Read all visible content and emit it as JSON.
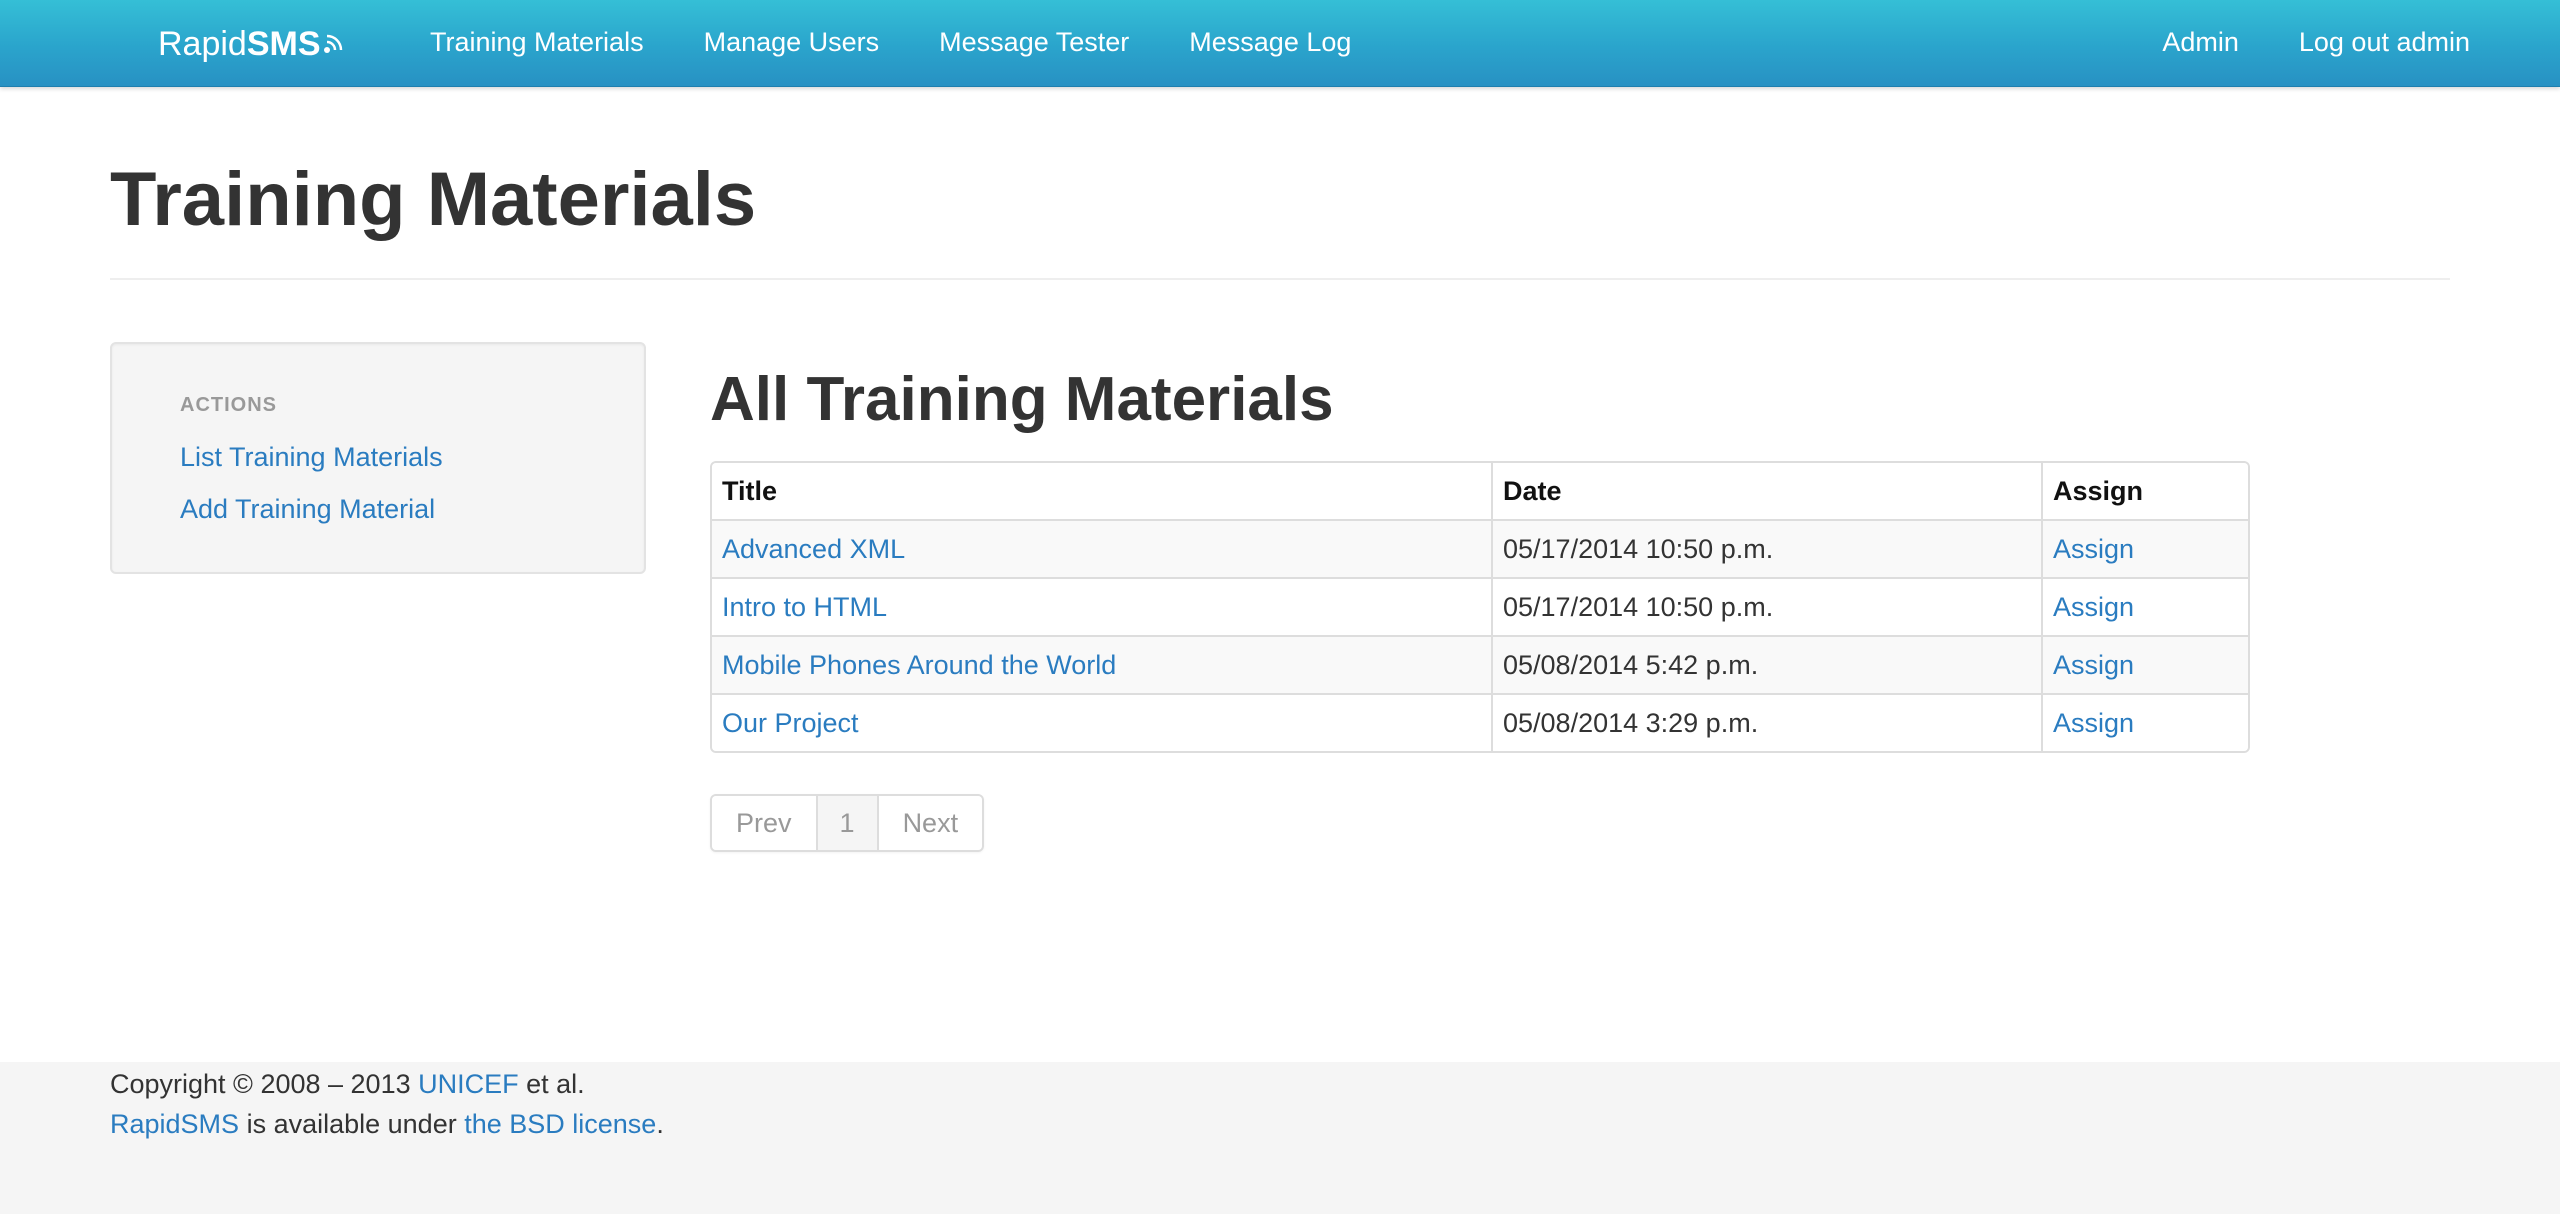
{
  "navbar": {
    "brand_light": "Rapid",
    "brand_bold": "SMS",
    "brand_icon": "signal-waves-icon",
    "left_items": [
      "Training Materials",
      "Manage Users",
      "Message Tester",
      "Message Log"
    ],
    "right_items": [
      "Admin",
      "Log out admin"
    ],
    "colors": {
      "gradient_top": "#35bfd6",
      "gradient_bottom": "#2891c3"
    }
  },
  "page": {
    "title": "Training Materials"
  },
  "sidebar": {
    "header": "ACTIONS",
    "links": [
      "List Training Materials",
      "Add Training Material"
    ]
  },
  "main": {
    "section_title": "All Training Materials",
    "table": {
      "columns": [
        "Title",
        "Date",
        "Assign"
      ],
      "rows": [
        {
          "title": "Advanced XML",
          "date": "05/17/2014 10:50 p.m.",
          "assign": "Assign"
        },
        {
          "title": "Intro to HTML",
          "date": "05/17/2014 10:50 p.m.",
          "assign": "Assign"
        },
        {
          "title": "Mobile Phones Around the World",
          "date": "05/08/2014 5:42 p.m.",
          "assign": "Assign"
        },
        {
          "title": "Our Project",
          "date": "05/08/2014 3:29 p.m.",
          "assign": "Assign"
        }
      ]
    },
    "pagination": {
      "prev": "Prev",
      "current": "1",
      "next": "Next"
    }
  },
  "footer": {
    "line1_prefix": "Copyright © 2008 – 2013 ",
    "line1_link": "UNICEF",
    "line1_suffix": " et al.",
    "line2_link1": "RapidSMS",
    "line2_middle": " is available under ",
    "line2_link2": "the BSD license",
    "line2_suffix": "."
  },
  "colors": {
    "link": "#2a7cc0",
    "text": "#333333",
    "footer_bg": "#f5f5f5",
    "sidebar_bg": "#f5f5f5"
  }
}
